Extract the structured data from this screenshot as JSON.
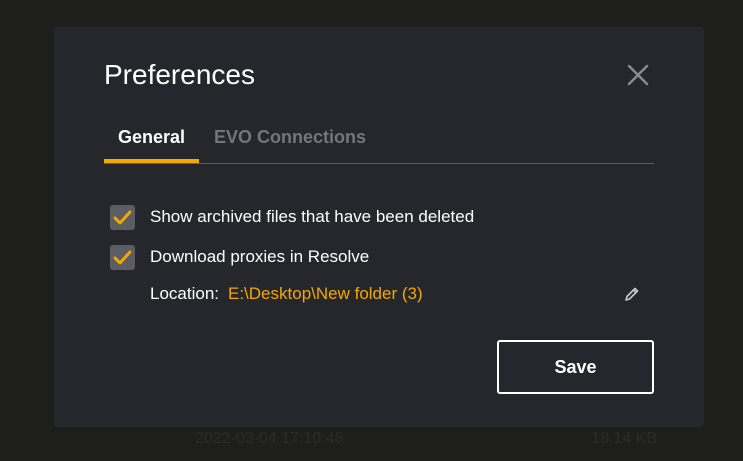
{
  "background": {
    "row_date": "2022-03-04 17:10:48",
    "row_size": "18.14 KB"
  },
  "dialog": {
    "title": "Preferences",
    "close_icon": "close-icon",
    "tabs": [
      {
        "label": "General",
        "active": true
      },
      {
        "label": "EVO Connections",
        "active": false
      }
    ],
    "options": [
      {
        "label": "Show archived files that have been deleted",
        "checked": true
      },
      {
        "label": "Download proxies in Resolve",
        "checked": true
      }
    ],
    "location": {
      "label": "Location:",
      "path": "E:\\Desktop\\New folder (3)",
      "edit_icon": "pencil-icon"
    },
    "save_label": "Save"
  },
  "colors": {
    "accent": "#f2a900",
    "dialog_bg": "#25272c",
    "checkbox_bg": "#5b5d62",
    "inactive_tab": "#74767a"
  }
}
